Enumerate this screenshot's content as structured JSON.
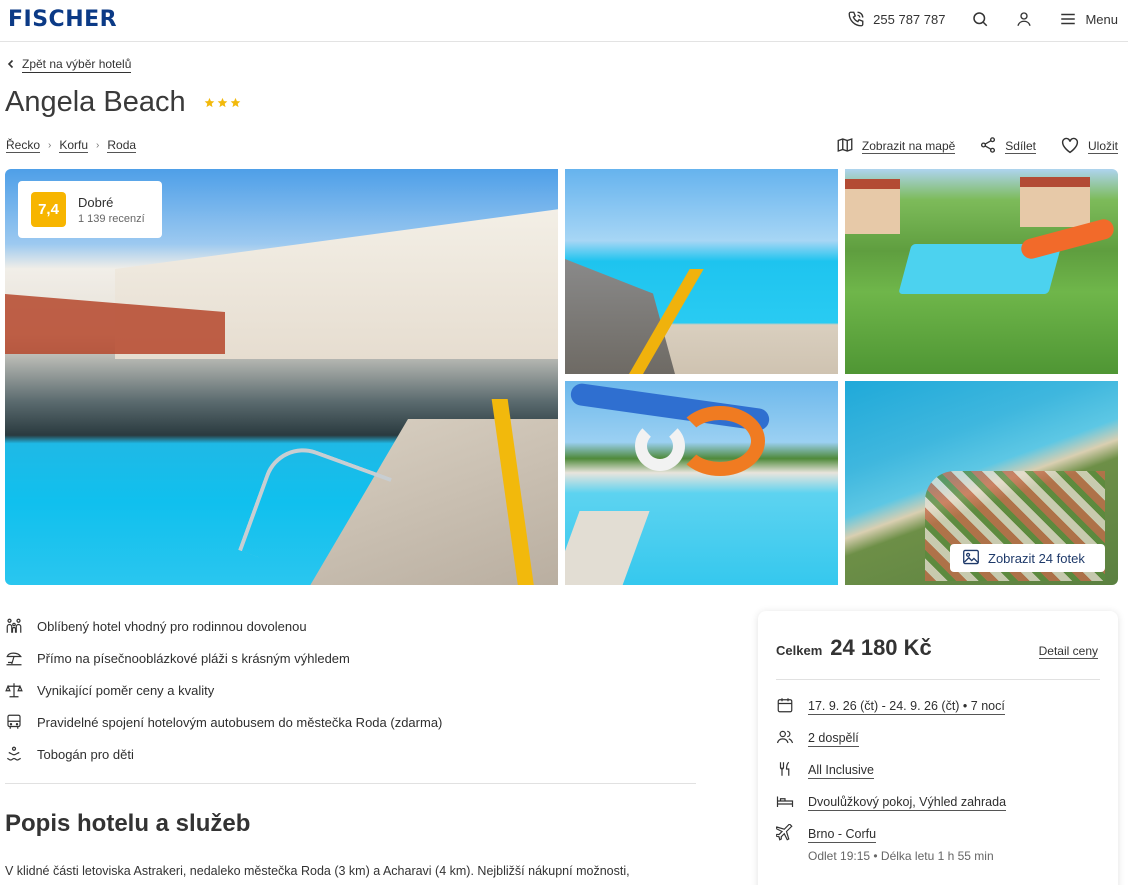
{
  "header": {
    "logo": "FISCHER",
    "phone": "255 787 787",
    "menu_label": "Menu"
  },
  "back_link": "Zpět na výběr hotelů",
  "hotel": {
    "name": "Angela Beach",
    "stars": 3,
    "star_color": "#f2b90c"
  },
  "breadcrumb": [
    "Řecko",
    "Korfu",
    "Roda"
  ],
  "actions": {
    "map": "Zobrazit na mapě",
    "share": "Sdílet",
    "save": "Uložit"
  },
  "rating": {
    "score": "7,4",
    "label": "Dobré",
    "reviews": "1 139 recenzí",
    "badge_color": "#f7b500"
  },
  "gallery": {
    "show_photos": "Zobrazit 24 fotek"
  },
  "features": [
    {
      "icon": "family-icon",
      "text": "Oblíbený hotel vhodný pro rodinnou dovolenou"
    },
    {
      "icon": "beach-icon",
      "text": "Přímo na písečnooblázkové pláži s krásným výhledem"
    },
    {
      "icon": "scales-icon",
      "text": "Vynikající poměr ceny a kvality"
    },
    {
      "icon": "bus-icon",
      "text": "Pravidelné spojení hotelovým autobusem do městečka Roda (zdarma)"
    },
    {
      "icon": "waterslide-icon",
      "text": "Tobogán pro děti"
    }
  ],
  "description": {
    "title": "Popis hotelu a služeb",
    "text": "V klidné části letoviska Astrakeri, nedaleko městečka Roda (3 km) a Acharavi (4 km). Nejbližší nákupní možnosti,"
  },
  "price": {
    "label": "Celkem",
    "value": "24 180 Kč",
    "detail": "Detail ceny",
    "dates": "17. 9. 26 (čt) - 24. 9. 26 (čt) • 7 nocí",
    "persons": "2 dospělí",
    "board": "All Inclusive",
    "room": "Dvoulůžkový pokoj, Výhled zahrada",
    "flight": "Brno - Corfu",
    "flight_info": "Odlet 19:15 • Délka letu 1 h 55 min"
  }
}
